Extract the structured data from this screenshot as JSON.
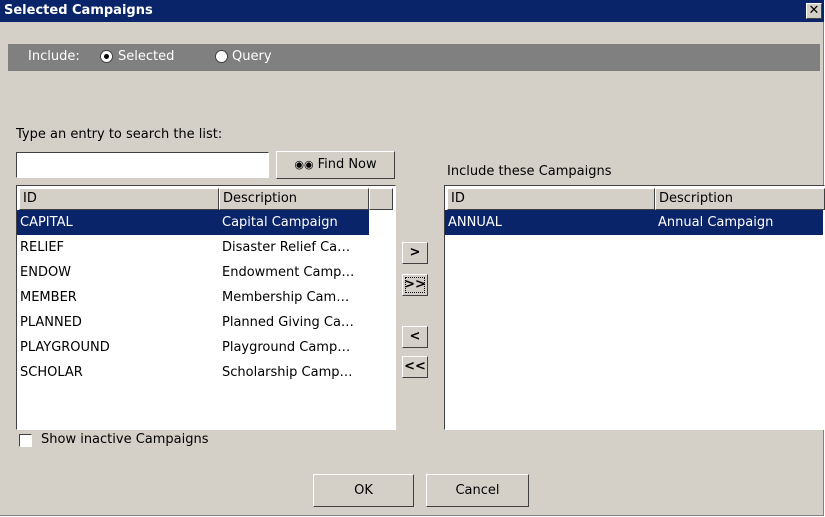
{
  "window": {
    "title": "Selected Campaigns",
    "close_label": "✕"
  },
  "include": {
    "label": "Include:",
    "options": [
      {
        "label": "Selected",
        "checked": true
      },
      {
        "label": "Query",
        "checked": false
      }
    ]
  },
  "search": {
    "label": "Type an entry to search the list:",
    "value": "",
    "find_label": "Find Now",
    "find_icon": "binoculars-icon"
  },
  "available": {
    "columns": [
      "ID",
      "Description"
    ],
    "rows": [
      {
        "id": "CAPITAL",
        "description": "Capital Campaign"
      },
      {
        "id": "RELIEF",
        "description": "Disaster Relief Ca…"
      },
      {
        "id": "ENDOW",
        "description": "Endowment Camp…"
      },
      {
        "id": "MEMBER",
        "description": "Membership Cam…"
      },
      {
        "id": "PLANNED",
        "description": "Planned Giving Ca…"
      },
      {
        "id": "PLAYGROUND",
        "description": "Playground Camp…"
      },
      {
        "id": "SCHOLAR",
        "description": "Scholarship Camp…"
      }
    ],
    "selected_index": 0
  },
  "included": {
    "label": "Include these Campaigns",
    "columns": [
      "ID",
      "Description"
    ],
    "rows": [
      {
        "id": "ANNUAL",
        "description": "Annual Campaign"
      }
    ],
    "selected_index": 0
  },
  "move_buttons": {
    "add": ">",
    "add_all": ">>",
    "remove": "<",
    "remove_all": "<<"
  },
  "show_inactive": {
    "label": "Show inactive Campaigns",
    "checked": false
  },
  "footer": {
    "ok": "OK",
    "cancel": "Cancel"
  },
  "colors": {
    "titlebar": "#0a246a",
    "selection": "#0a246a",
    "dialog_bg": "#d4d0c8",
    "include_bar": "#808080"
  }
}
